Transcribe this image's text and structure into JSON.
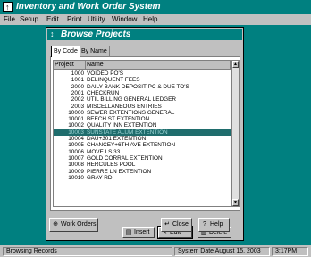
{
  "app": {
    "title": "Inventory and Work Order System",
    "icon_glyph": "↑"
  },
  "menu": [
    "File",
    "Setup",
    "Edit",
    "Print",
    "Utility",
    "Window",
    "Help"
  ],
  "dialog": {
    "title": "Browse Projects",
    "icon_glyph": "↕",
    "tabs": [
      "By Code",
      "By Name"
    ],
    "columns": [
      "Project",
      "Name"
    ],
    "rows": [
      {
        "code": "1000",
        "name": "VOIDED PO'S"
      },
      {
        "code": "1001",
        "name": "DELINQUENT FEES"
      },
      {
        "code": "2000",
        "name": "DAILY BANK DEPOSIT-PC & DUE TO'S"
      },
      {
        "code": "2001",
        "name": "CHECKRUN"
      },
      {
        "code": "2002",
        "name": "UTIL BILLING GENERAL LEDGER"
      },
      {
        "code": "2003",
        "name": "MISCELLANEOUS ENTRIES"
      },
      {
        "code": "10000",
        "name": "SEWER EXTENTIONS GENERAL"
      },
      {
        "code": "10001",
        "name": "BEECH ST EXTENTION"
      },
      {
        "code": "10002",
        "name": "QUALITY INN EXTENTION"
      },
      {
        "code": "10003",
        "name": "SUNSTATE ALUM EXTENTION"
      },
      {
        "code": "10004",
        "name": "DAU+301 EXTENTION"
      },
      {
        "code": "10005",
        "name": "CHANCEY+6TH AVE EXTENTION"
      },
      {
        "code": "10006",
        "name": "MOVE LS 33"
      },
      {
        "code": "10007",
        "name": "GOLD CORRAL EXTENTION"
      },
      {
        "code": "10008",
        "name": "HERCULES POOL"
      },
      {
        "code": "10009",
        "name": "PIERRE LN EXTENTION"
      },
      {
        "code": "10010",
        "name": "GRAY RD"
      }
    ],
    "selected_index": 9,
    "buttons": {
      "insert": "Insert",
      "edit": "Edit",
      "delete": "Delete",
      "work_orders": "Work Orders",
      "close": "Close",
      "help": "Help"
    }
  },
  "status": {
    "message": "Browsing Records",
    "date": "System Date August 15, 2003",
    "time": "3:17PM"
  },
  "colors": {
    "desktop": "#008080",
    "title_bar": "#008080",
    "selection": "#1f6d6d"
  }
}
